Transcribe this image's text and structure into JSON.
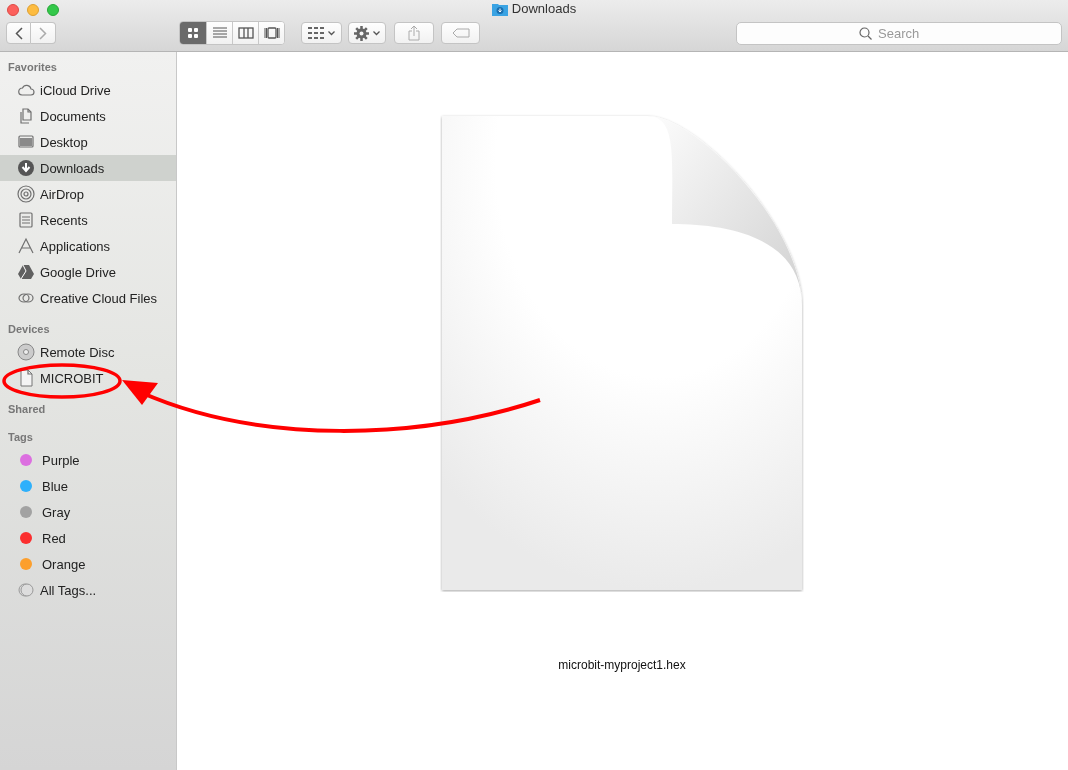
{
  "window": {
    "title": "Downloads"
  },
  "toolbar": {
    "views": [
      {
        "kind": "icon",
        "selected": true
      },
      {
        "kind": "list",
        "selected": false
      },
      {
        "kind": "columns",
        "selected": false
      },
      {
        "kind": "coverflow",
        "selected": false
      }
    ],
    "search": {
      "placeholder": "Search"
    }
  },
  "sidebar": {
    "sections": [
      {
        "title": "Favorites",
        "items": [
          {
            "label": "iCloud Drive",
            "kind": "cloud",
            "selected": false
          },
          {
            "label": "Documents",
            "kind": "documents",
            "selected": false
          },
          {
            "label": "Desktop",
            "kind": "desktop",
            "selected": false
          },
          {
            "label": "Downloads",
            "kind": "downloads",
            "selected": true
          },
          {
            "label": "AirDrop",
            "kind": "airdrop",
            "selected": false
          },
          {
            "label": "Recents",
            "kind": "recents",
            "selected": false
          },
          {
            "label": "Applications",
            "kind": "applications",
            "selected": false
          },
          {
            "label": "Google Drive",
            "kind": "drive",
            "selected": false
          },
          {
            "label": "Creative Cloud Files",
            "kind": "creative-cloud",
            "selected": false
          }
        ]
      },
      {
        "title": "Devices",
        "items": [
          {
            "label": "Remote Disc",
            "kind": "disc",
            "selected": false
          },
          {
            "label": "MICROBIT",
            "kind": "file",
            "selected": false
          }
        ]
      },
      {
        "title": "Shared"
      },
      {
        "title": "Tags",
        "items": [
          {
            "label": "Purple",
            "kind": "tag",
            "color": "#dc6fe0",
            "selected": false
          },
          {
            "label": "Blue",
            "kind": "tag",
            "color": "#2eb0fb",
            "selected": false
          },
          {
            "label": "Gray",
            "kind": "tag",
            "color": "#a2a2a2",
            "selected": false
          },
          {
            "label": "Red",
            "kind": "tag",
            "color": "#fb2f2f",
            "selected": false
          },
          {
            "label": "Orange",
            "kind": "tag",
            "color": "#fc9f2d",
            "selected": false
          },
          {
            "label": "All Tags...",
            "kind": "all-tags",
            "selected": false
          }
        ]
      }
    ]
  },
  "files": [
    {
      "name": "microbit-myproject1.hex"
    }
  ]
}
